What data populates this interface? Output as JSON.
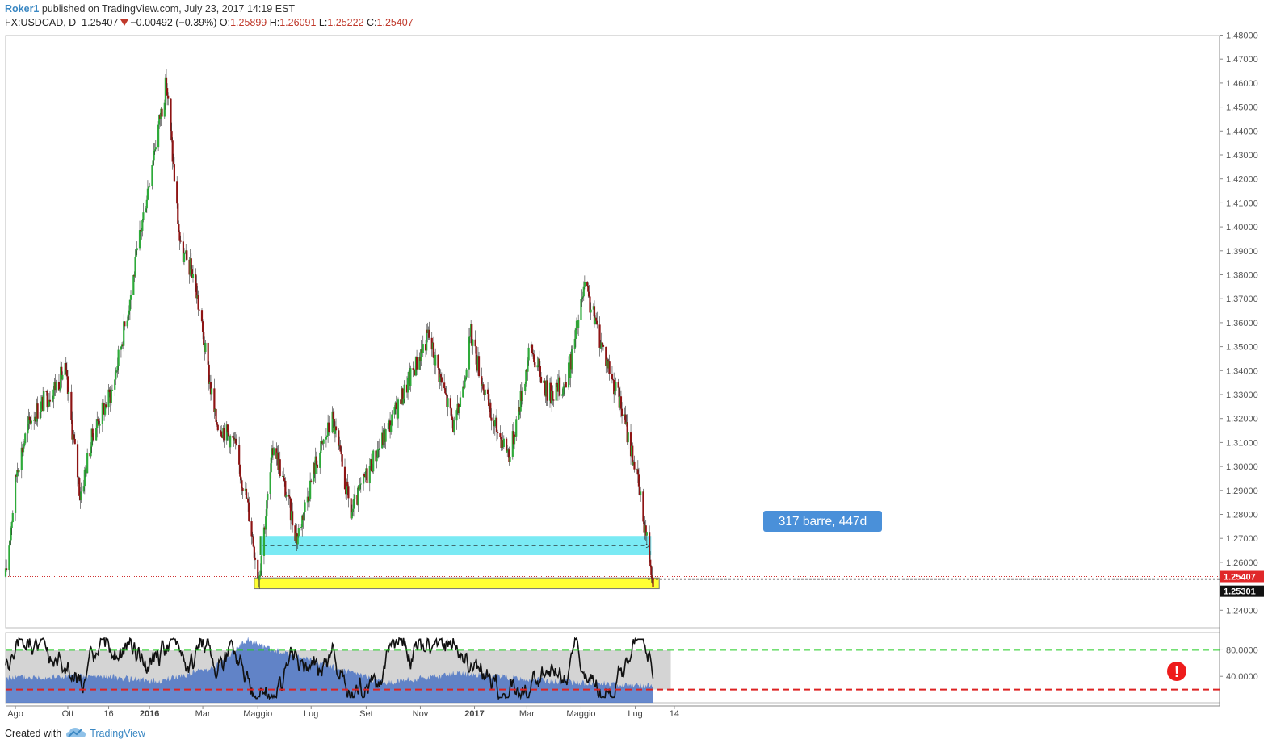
{
  "header": {
    "author": "Roker1",
    "published": "published on TradingView.com, July 23, 2017 14:19 EST",
    "symbol": "FX:USDCAD, D",
    "last": "1.25407",
    "change": "−0.00492 (−0.39%)",
    "o_label": "O:",
    "o_value": "1.25899",
    "h_label": "H:",
    "h_value": "1.26091",
    "l_label": "L:",
    "l_value": "1.25222",
    "c_label": "C:",
    "c_value": "1.25407"
  },
  "footer": {
    "created_with": "Created with",
    "brand": "TradingView"
  },
  "colors": {
    "up": "#2eaa3a",
    "down": "#8e1414",
    "cyan": "#63e6f2",
    "yellow": "#ffff33",
    "bubble": "#4a90d9",
    "price_tag": "#e0282a",
    "osc_fill": "#4c74c4",
    "osc_band": "#d4d4d4"
  },
  "annotations": {
    "measure_label": "317 barre, 447d",
    "current_price_tag": "1.25407",
    "support_price_tag": "1.25301",
    "alert_icon": "exclamation-icon"
  },
  "chart_data": [
    {
      "type": "candlestick",
      "ylim": [
        1.235,
        1.48
      ],
      "y_ticks": [
        "1.48000",
        "1.47000",
        "1.46000",
        "1.45000",
        "1.44000",
        "1.43000",
        "1.42000",
        "1.41000",
        "1.40000",
        "1.39000",
        "1.38000",
        "1.37000",
        "1.36000",
        "1.35000",
        "1.34000",
        "1.33000",
        "1.32000",
        "1.31000",
        "1.30000",
        "1.29000",
        "1.28000",
        "1.27000",
        "1.26000",
        "1.24000"
      ],
      "x_ticks": [
        "Ago",
        "Ott",
        "16",
        "2016",
        "Mar",
        "Maggio",
        "Lug",
        "Set",
        "Nov",
        "2017",
        "Mar",
        "Maggio",
        "Lug",
        "14"
      ],
      "price_path": [
        {
          "date": "2015-07-23",
          "close": 1.254
        },
        {
          "date": "2015-08-05",
          "close": 1.3
        },
        {
          "date": "2015-08-20",
          "close": 1.32
        },
        {
          "date": "2015-09-10",
          "close": 1.33
        },
        {
          "date": "2015-09-28",
          "close": 1.34
        },
        {
          "date": "2015-10-15",
          "close": 1.288
        },
        {
          "date": "2015-10-30",
          "close": 1.315
        },
        {
          "date": "2015-11-20",
          "close": 1.332
        },
        {
          "date": "2015-12-10",
          "close": 1.37
        },
        {
          "date": "2016-01-05",
          "close": 1.43
        },
        {
          "date": "2016-01-20",
          "close": 1.46
        },
        {
          "date": "2016-02-05",
          "close": 1.39
        },
        {
          "date": "2016-02-20",
          "close": 1.38
        },
        {
          "date": "2016-03-15",
          "close": 1.32
        },
        {
          "date": "2016-04-05",
          "close": 1.31
        },
        {
          "date": "2016-04-20",
          "close": 1.285
        },
        {
          "date": "2016-05-03",
          "close": 1.254
        },
        {
          "date": "2016-05-20",
          "close": 1.31
        },
        {
          "date": "2016-06-15",
          "close": 1.27
        },
        {
          "date": "2016-07-05",
          "close": 1.3
        },
        {
          "date": "2016-07-25",
          "close": 1.32
        },
        {
          "date": "2016-08-15",
          "close": 1.28
        },
        {
          "date": "2016-09-05",
          "close": 1.3
        },
        {
          "date": "2016-10-01",
          "close": 1.32
        },
        {
          "date": "2016-11-10",
          "close": 1.355
        },
        {
          "date": "2016-12-10",
          "close": 1.315
        },
        {
          "date": "2016-12-28",
          "close": 1.355
        },
        {
          "date": "2017-01-20",
          "close": 1.32
        },
        {
          "date": "2017-02-10",
          "close": 1.305
        },
        {
          "date": "2017-03-05",
          "close": 1.35
        },
        {
          "date": "2017-03-25",
          "close": 1.33
        },
        {
          "date": "2017-04-15",
          "close": 1.335
        },
        {
          "date": "2017-05-05",
          "close": 1.375
        },
        {
          "date": "2017-05-25",
          "close": 1.35
        },
        {
          "date": "2017-06-15",
          "close": 1.325
        },
        {
          "date": "2017-07-01",
          "close": 1.3
        },
        {
          "date": "2017-07-21",
          "close": 1.254
        }
      ],
      "last_price": 1.25407,
      "support_level": 1.25301,
      "measure_zone": {
        "from": "2016-05-05",
        "to": "2017-07-19",
        "low": 1.263,
        "high": 1.271,
        "label": "317 barre, 447d"
      },
      "support_zone": {
        "from": "2016-04-28",
        "to": "2017-07-28",
        "low": 1.249,
        "high": 1.2535
      }
    },
    {
      "type": "line",
      "indicator": "oscillator",
      "ylim": [
        0,
        100
      ],
      "y_ticks": [
        "80.0000",
        "40.0000"
      ],
      "upper_band": 80,
      "lower_band": 20
    }
  ]
}
